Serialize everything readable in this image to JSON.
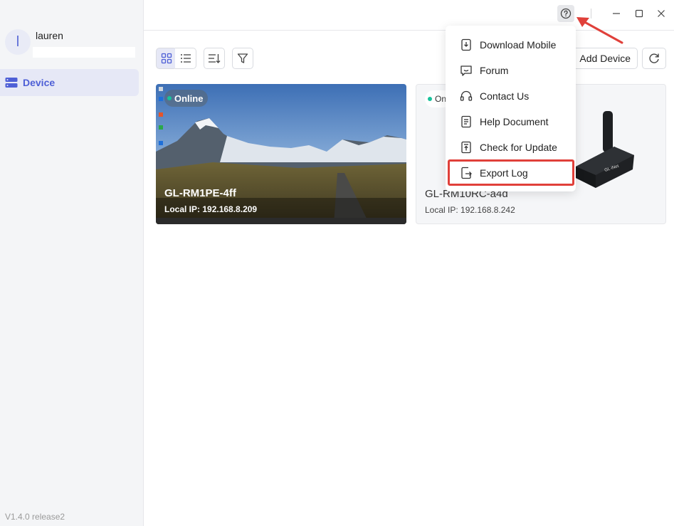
{
  "user": {
    "initial": "l",
    "name": "lauren"
  },
  "sidebar": {
    "items": [
      {
        "label": "Device",
        "icon": "server-icon"
      }
    ]
  },
  "version": "V1.4.0 release2",
  "toolbar": {
    "add_device_label": "Add Device",
    "view_buttons": [
      "grid-view-icon",
      "list-view-icon",
      "sort-icon",
      "filter-icon"
    ]
  },
  "devices": [
    {
      "name": "GL-RM1PE-4ff",
      "ip": "Local IP: 192.168.8.209",
      "status": "Online"
    },
    {
      "name": "GL-RM10RC-a4d",
      "ip": "Local IP: 192.168.8.242",
      "status": "On"
    }
  ],
  "help_menu": {
    "items": [
      {
        "label": "Download Mobile",
        "icon": "mobile-download-icon"
      },
      {
        "label": "Forum",
        "icon": "chat-icon"
      },
      {
        "label": "Contact Us",
        "icon": "headset-icon"
      },
      {
        "label": "Help Document",
        "icon": "document-icon"
      },
      {
        "label": "Check for Update",
        "icon": "update-icon"
      },
      {
        "label": "Export Log",
        "icon": "export-icon"
      }
    ]
  },
  "colors": {
    "accent": "#4e5fd6",
    "online": "#17c29b",
    "annotation": "#e0403a"
  }
}
